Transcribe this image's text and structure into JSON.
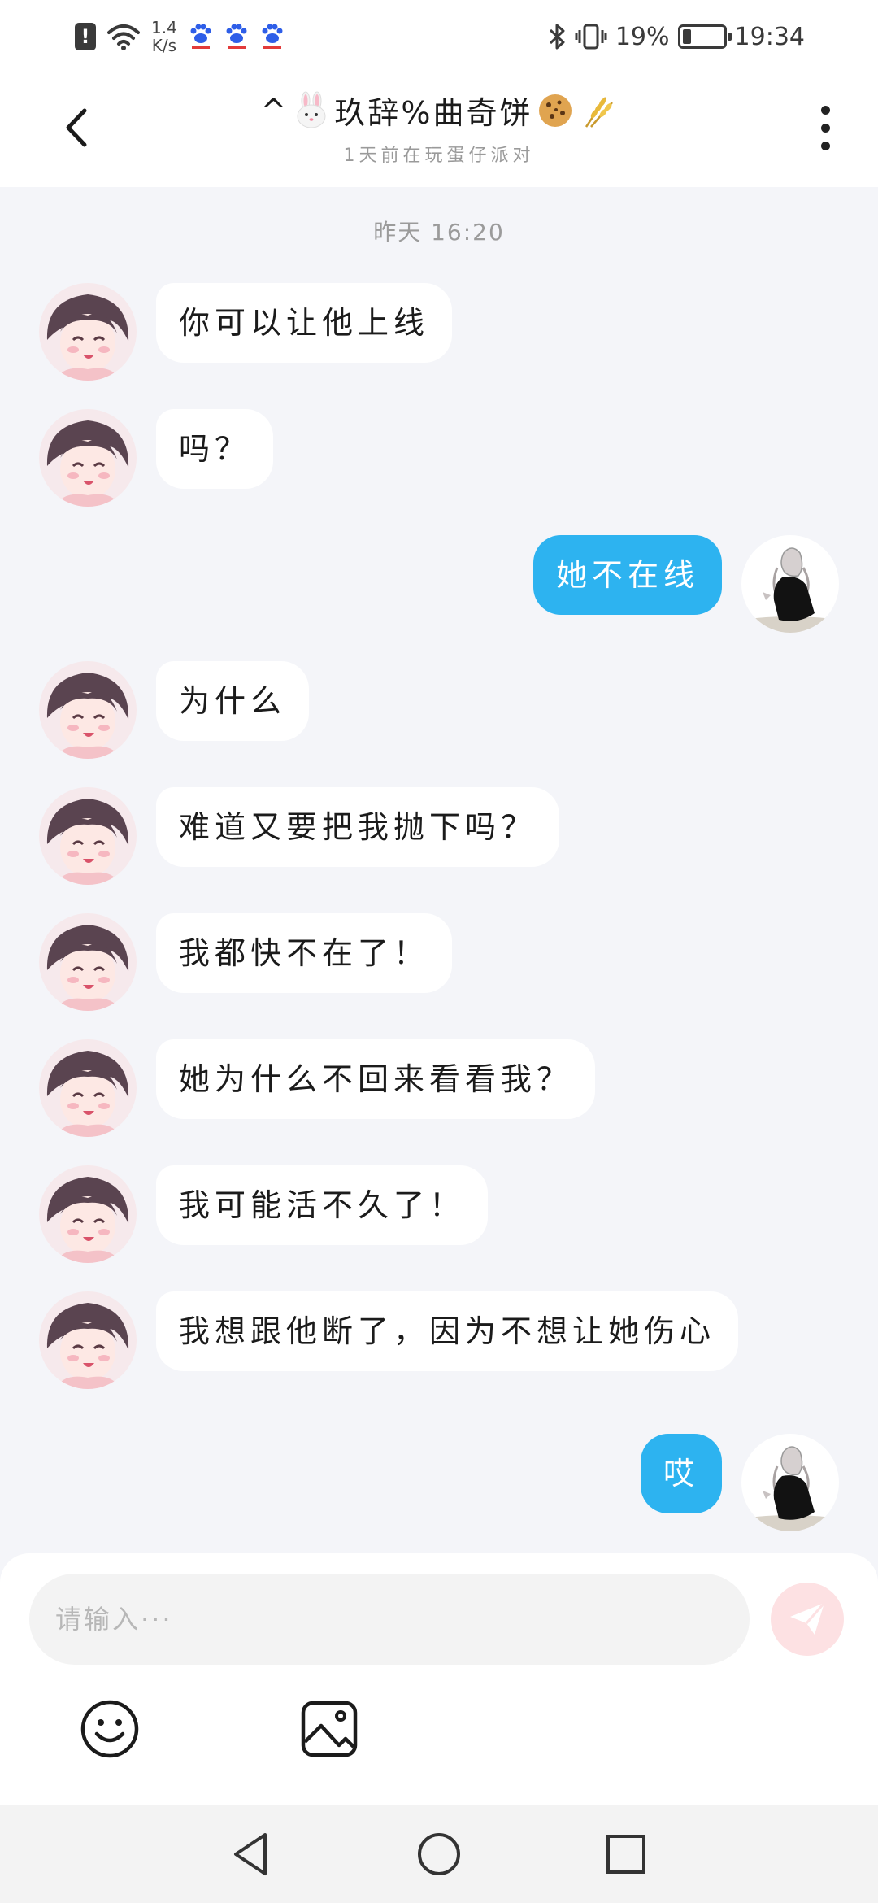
{
  "status_bar": {
    "net_speed_value": "1.4",
    "net_speed_unit": "K/s",
    "battery_percent": "19%",
    "time": "19:34"
  },
  "header": {
    "title_prefix": "^",
    "title_text": "玖辞%曲奇饼",
    "subtitle": "1天前在玩蛋仔派对",
    "title_emojis": [
      "rabbit-face-emoji",
      "cookie-emoji",
      "wheat-emoji"
    ]
  },
  "chat": {
    "timestamp": "昨天 16:20",
    "messages": [
      {
        "side": "left",
        "text": "你可以让他上线"
      },
      {
        "side": "left",
        "text": "吗？"
      },
      {
        "side": "right",
        "text": "她不在线"
      },
      {
        "side": "left",
        "text": "为什么"
      },
      {
        "side": "left",
        "text": "难道又要把我抛下吗？"
      },
      {
        "side": "left",
        "text": "我都快不在了！"
      },
      {
        "side": "left",
        "text": "她为什么不回来看看我？"
      },
      {
        "side": "left",
        "text": "我可能活不久了！"
      },
      {
        "side": "left",
        "text": "我想跟他断了，因为不想让她伤心"
      },
      {
        "side": "right",
        "text": "哎"
      }
    ]
  },
  "composer": {
    "placeholder": "请输入···",
    "value": ""
  },
  "colors": {
    "accent_blue": "#2db3f0",
    "chat_background": "#f4f5f9",
    "send_button_disabled": "#fde1e3"
  }
}
